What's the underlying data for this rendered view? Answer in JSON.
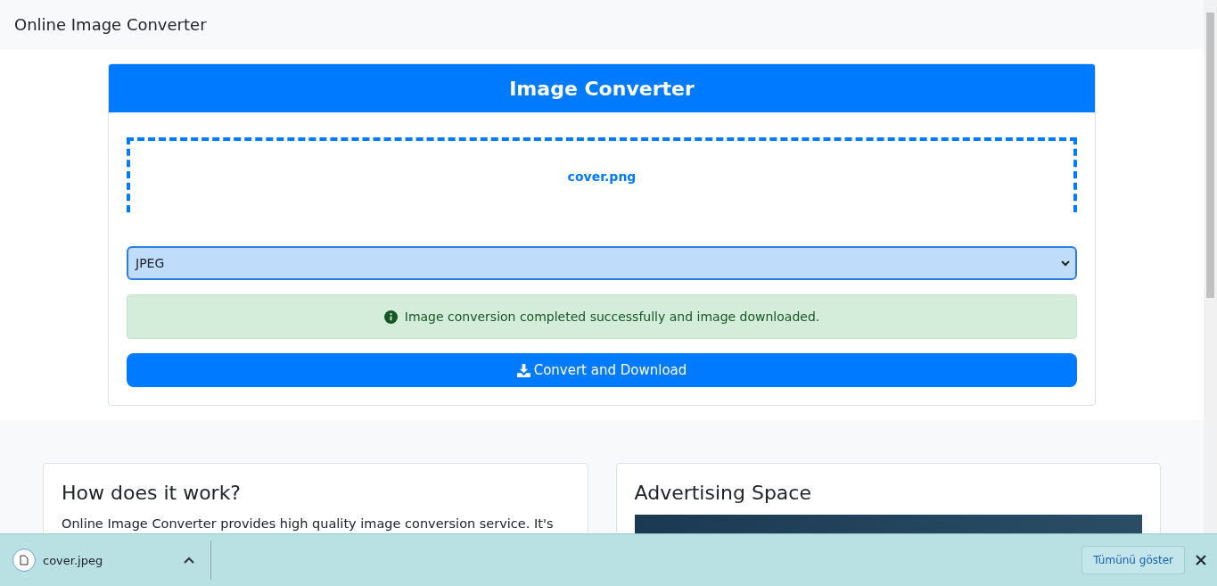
{
  "navbar": {
    "brand": "Online Image Converter"
  },
  "converter": {
    "title": "Image Converter",
    "file_name": "cover.png",
    "format": "JPEG",
    "alert": "Image conversion completed successfully and image downloaded.",
    "button": "Convert and Download"
  },
  "info_cards": [
    {
      "kind": "text",
      "title": "How does it work?",
      "text": "Online Image Converter provides high quality image conversion service. It's"
    },
    {
      "kind": "image",
      "title": "Advertising Space"
    }
  ],
  "download_bar": {
    "file": "cover.jpeg",
    "show_all": "Tümünü göster"
  }
}
